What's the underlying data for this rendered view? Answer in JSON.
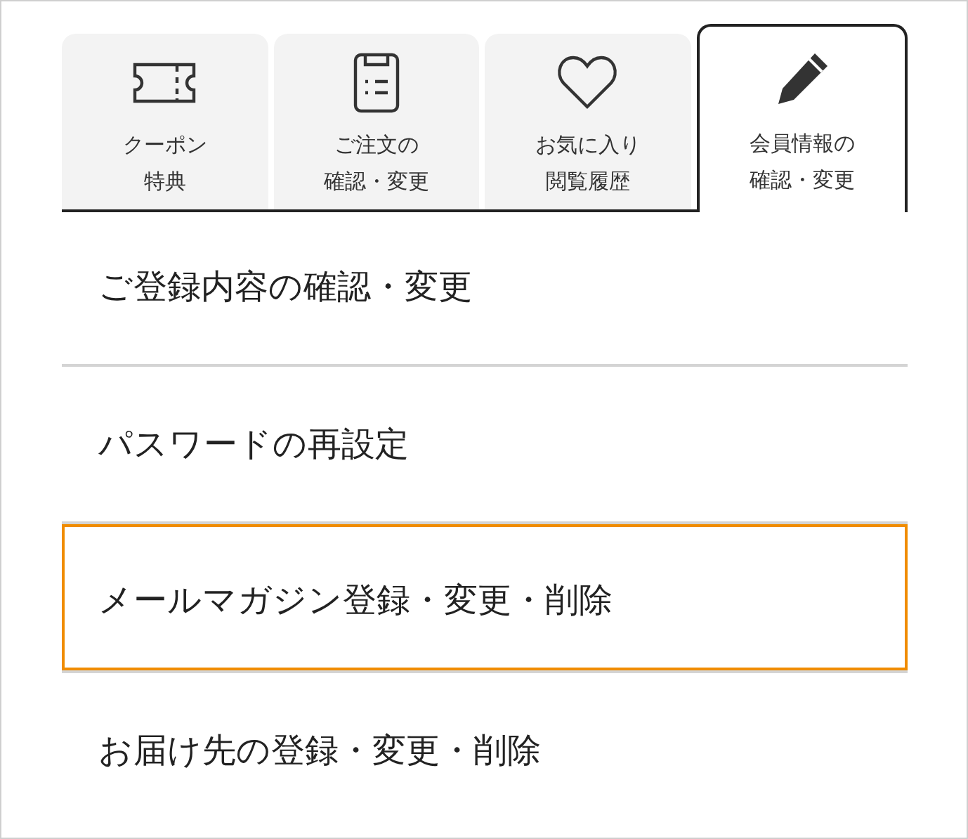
{
  "tabs": [
    {
      "label": [
        "クーポン",
        "特典"
      ],
      "selected": false
    },
    {
      "label": [
        "ご注文の",
        "確認・変更"
      ],
      "selected": false
    },
    {
      "label": [
        "お気に入り",
        "閲覧履歴"
      ],
      "selected": false
    },
    {
      "label": [
        "会員情報の",
        "確認・変更"
      ],
      "selected": true
    }
  ],
  "menu": [
    {
      "label": "ご登録内容の確認・変更",
      "selected": false
    },
    {
      "label": "パスワードの再設定",
      "selected": false
    },
    {
      "label": "メールマガジン登録・変更・削除",
      "selected": true
    },
    {
      "label": "お届け先の登録・変更・削除",
      "selected": false
    }
  ]
}
